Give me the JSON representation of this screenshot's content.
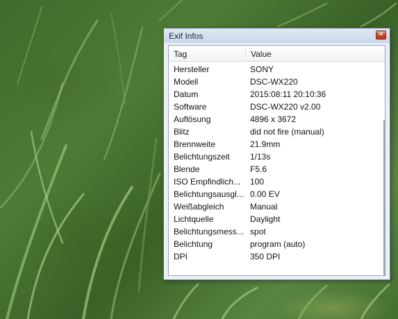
{
  "background": {
    "description_colors": [
      "#3f6a2c",
      "#5a8540"
    ]
  },
  "window": {
    "title": "Exif Infos",
    "close_glyph": "✕",
    "columns": {
      "tag": "Tag",
      "value": "Value"
    },
    "rows": [
      {
        "tag": "Hersteller",
        "value": "SONY"
      },
      {
        "tag": "Modell",
        "value": "DSC-WX220"
      },
      {
        "tag": "Datum",
        "value": "2015:08:11 20:10:36"
      },
      {
        "tag": "Software",
        "value": "DSC-WX220 v2.00"
      },
      {
        "tag": "Auflösung",
        "value": "4896 x 3672"
      },
      {
        "tag": "Blitz",
        "value": "did not fire (manual)"
      },
      {
        "tag": "Brennweite",
        "value": "21.9mm"
      },
      {
        "tag": "Belichtungszeit",
        "value": "1/13s"
      },
      {
        "tag": "Blende",
        "value": "F5.6"
      },
      {
        "tag": "ISO Empfindlich...",
        "value": "100"
      },
      {
        "tag": "Belichtungsausgl...",
        "value": "0.00 EV"
      },
      {
        "tag": "Weißabgleich",
        "value": "Manual"
      },
      {
        "tag": "Lichtquelle",
        "value": "Daylight"
      },
      {
        "tag": "Belichtungsmess...",
        "value": "spot"
      },
      {
        "tag": "Belichtung",
        "value": "program (auto)"
      },
      {
        "tag": "DPI",
        "value": "350 DPI"
      }
    ]
  }
}
